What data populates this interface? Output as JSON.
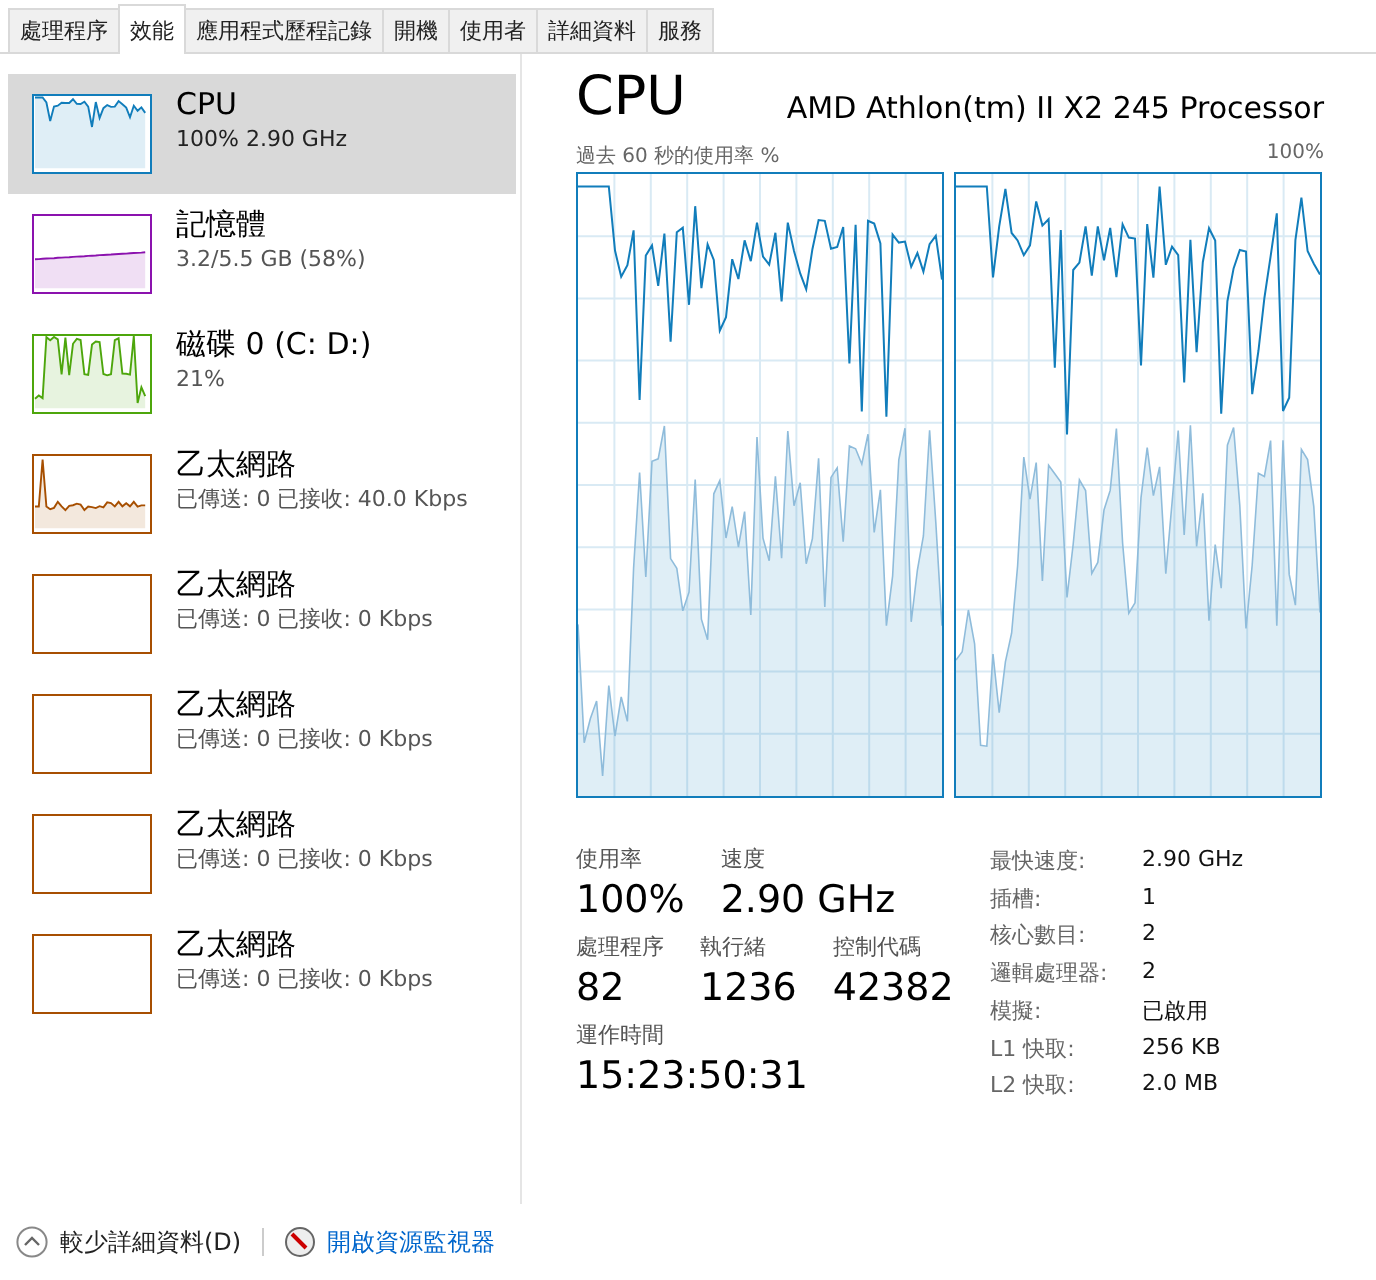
{
  "tabs": [
    {
      "label": "處理程序",
      "selected": false
    },
    {
      "label": "效能",
      "selected": true
    },
    {
      "label": "應用程式歷程記錄",
      "selected": false
    },
    {
      "label": "開機",
      "selected": false
    },
    {
      "label": "使用者",
      "selected": false
    },
    {
      "label": "詳細資料",
      "selected": false
    },
    {
      "label": "服務",
      "selected": false
    }
  ],
  "sidebar": {
    "items": [
      {
        "name": "CPU",
        "detail": "100%  2.90 GHz",
        "kind": "cpu",
        "color": "#117dbb",
        "selected": true
      },
      {
        "name": "記憶體",
        "detail": "3.2/5.5 GB (58%)",
        "kind": "memory",
        "color": "#8b12ae",
        "selected": false
      },
      {
        "name": "磁碟 0 (C: D:)",
        "detail": "21%",
        "kind": "disk",
        "color": "#4da60c",
        "selected": false
      },
      {
        "name": "乙太網路",
        "detail": "已傳送: 0 已接收: 40.0 Kbps",
        "kind": "network",
        "color": "#a74f01",
        "selected": false
      },
      {
        "name": "乙太網路",
        "detail": "已傳送: 0 已接收: 0 Kbps",
        "kind": "idle",
        "color": "#a74f01",
        "selected": false
      },
      {
        "name": "乙太網路",
        "detail": "已傳送: 0 已接收: 0 Kbps",
        "kind": "idle",
        "color": "#a74f01",
        "selected": false
      },
      {
        "name": "乙太網路",
        "detail": "已傳送: 0 已接收: 0 Kbps",
        "kind": "idle",
        "color": "#a74f01",
        "selected": false
      },
      {
        "name": "乙太網路",
        "detail": "已傳送: 0 已接收: 0 Kbps",
        "kind": "idle",
        "color": "#a74f01",
        "selected": false
      }
    ]
  },
  "main": {
    "title": "CPU",
    "model": "AMD Athlon(tm) II X2 245 Processor",
    "graph_label": "過去 60 秒的使用率 %",
    "graph_max": "100%",
    "stat_rows": [
      [
        {
          "label": "使用率",
          "value": "100%"
        },
        {
          "label": "速度",
          "value": "2.90 GHz"
        }
      ],
      [
        {
          "label": "處理程序",
          "value": "82"
        },
        {
          "label": "執行緒",
          "value": "1236"
        },
        {
          "label": "控制代碼",
          "value": "42382"
        }
      ],
      [
        {
          "label": "運作時間",
          "value": "15:23:50:31"
        }
      ]
    ],
    "specs": [
      {
        "label": "最快速度:",
        "value": "2.90 GHz"
      },
      {
        "label": "插槽:",
        "value": "1"
      },
      {
        "label": "核心數目:",
        "value": "2"
      },
      {
        "label": "邏輯處理器:",
        "value": "2"
      },
      {
        "label": "模擬:",
        "value": "已啟用"
      },
      {
        "label": "L1 快取:",
        "value": "256 KB"
      },
      {
        "label": "L2 快取:",
        "value": "2.0 MB"
      }
    ]
  },
  "footer": {
    "fewer_details": "較少詳細資料(D)",
    "monitor_link": "開啟資源監視器"
  }
}
